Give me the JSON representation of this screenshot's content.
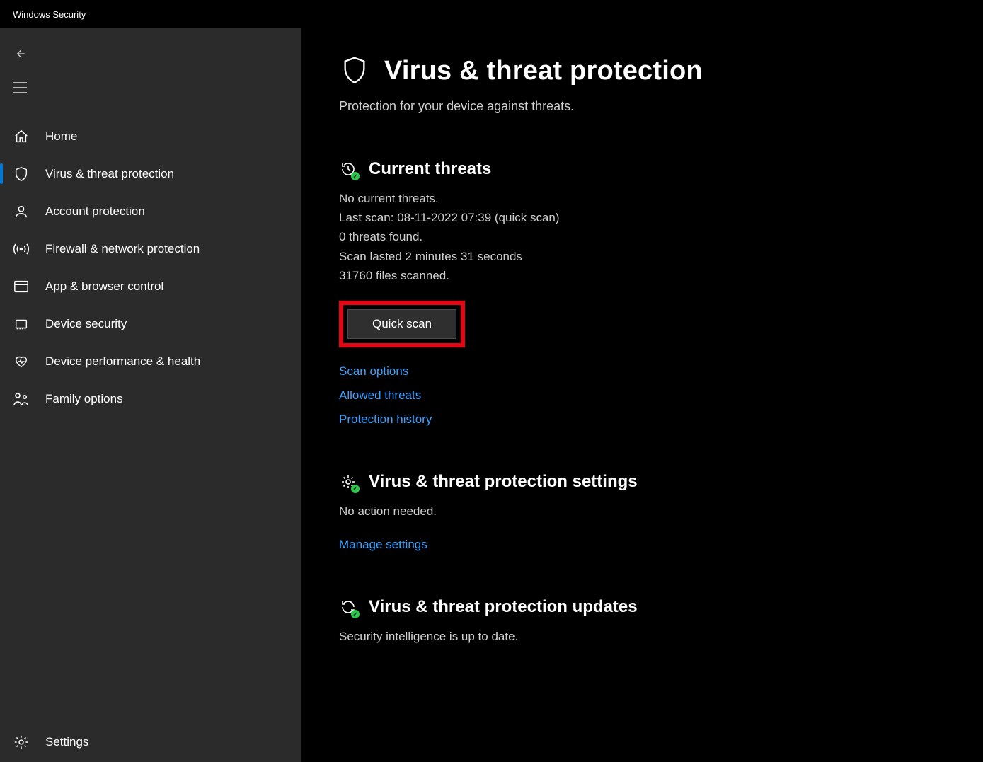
{
  "app": {
    "title": "Windows Security"
  },
  "sidebar": {
    "items": [
      {
        "label": "Home"
      },
      {
        "label": "Virus & threat protection"
      },
      {
        "label": "Account protection"
      },
      {
        "label": "Firewall & network protection"
      },
      {
        "label": "App & browser control"
      },
      {
        "label": "Device security"
      },
      {
        "label": "Device performance & health"
      },
      {
        "label": "Family options"
      }
    ],
    "settings_label": "Settings"
  },
  "page": {
    "title": "Virus & threat protection",
    "subtitle": "Protection for your device against threats."
  },
  "threats": {
    "heading": "Current threats",
    "status": "No current threats.",
    "last_scan": "Last scan: 08-11-2022 07:39 (quick scan)",
    "found": "0 threats found.",
    "duration": "Scan lasted 2 minutes 31 seconds",
    "files": "31760 files scanned.",
    "quick_scan_label": "Quick scan",
    "links": {
      "scan_options": "Scan options",
      "allowed_threats": "Allowed threats",
      "protection_history": "Protection history"
    }
  },
  "settings_section": {
    "heading": "Virus & threat protection settings",
    "status": "No action needed.",
    "manage_link": "Manage settings"
  },
  "updates_section": {
    "heading": "Virus & threat protection updates",
    "status": "Security intelligence is up to date."
  }
}
